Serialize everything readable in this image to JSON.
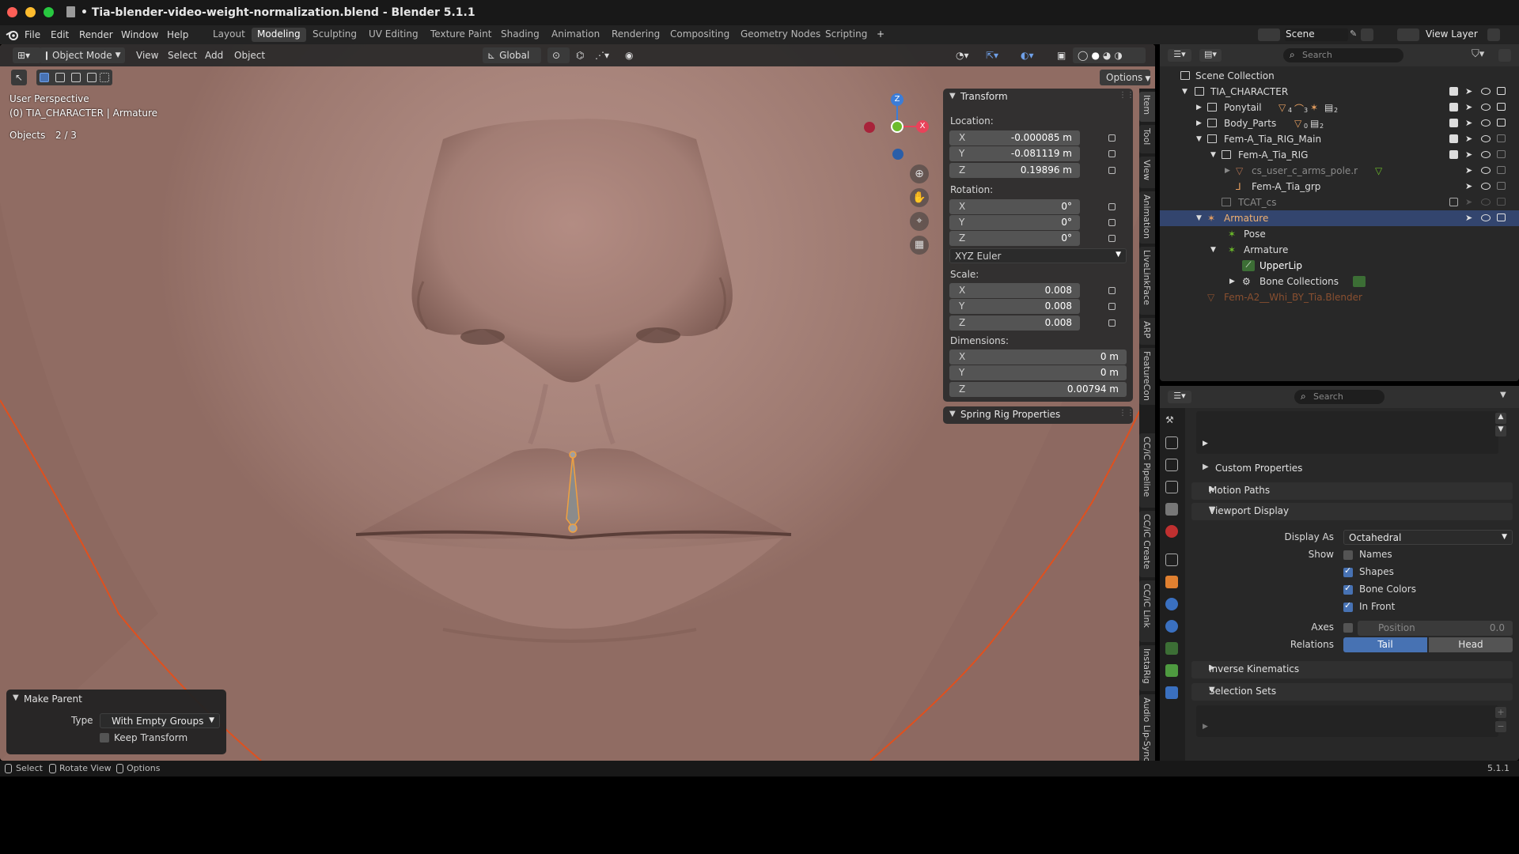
{
  "window": {
    "title": "• Tia-blender-video-weight-normalization.blend - Blender 5.1.1"
  },
  "menu": [
    "File",
    "Edit",
    "Render",
    "Window",
    "Help"
  ],
  "workspaces": [
    {
      "label": "Layout"
    },
    {
      "label": "Modeling",
      "active": true
    },
    {
      "label": "Sculpting"
    },
    {
      "label": "UV Editing"
    },
    {
      "label": "Texture Paint"
    },
    {
      "label": "Shading"
    },
    {
      "label": "Animation"
    },
    {
      "label": "Rendering"
    },
    {
      "label": "Compositing"
    },
    {
      "label": "Geometry Nodes"
    },
    {
      "label": "Scripting"
    },
    {
      "label": "+"
    }
  ],
  "top_right": {
    "scene": "Scene",
    "view_layer": "View Layer"
  },
  "viewport": {
    "mode": "Object Mode",
    "menus": [
      "View",
      "Select",
      "Add",
      "Object"
    ],
    "orientation": "Global",
    "options_label": "Options",
    "perspective": "User Perspective",
    "context": "(0) TIA_CHARACTER | Armature",
    "objects_label": "Objects",
    "objects_count": "2 / 3",
    "gizmo": {
      "z": "Z",
      "x": "X"
    }
  },
  "transform_panel": {
    "title": "Transform",
    "location_label": "Location:",
    "location": [
      {
        "axis": "X",
        "value": "-0.000085 m"
      },
      {
        "axis": "Y",
        "value": "-0.081119 m"
      },
      {
        "axis": "Z",
        "value": "0.19896 m"
      }
    ],
    "rotation_label": "Rotation:",
    "rotation": [
      {
        "axis": "X",
        "value": "0°"
      },
      {
        "axis": "Y",
        "value": "0°"
      },
      {
        "axis": "Z",
        "value": "0°"
      }
    ],
    "rotation_mode": "XYZ Euler",
    "scale_label": "Scale:",
    "scale": [
      {
        "axis": "X",
        "value": "0.008"
      },
      {
        "axis": "Y",
        "value": "0.008"
      },
      {
        "axis": "Z",
        "value": "0.008"
      }
    ],
    "dimensions_label": "Dimensions:",
    "dimensions": [
      {
        "axis": "X",
        "value": "0 m"
      },
      {
        "axis": "Y",
        "value": "0 m"
      },
      {
        "axis": "Z",
        "value": "0.00794 m"
      }
    ],
    "spring_rig": "Spring Rig Properties"
  },
  "side_tabs": [
    "Item",
    "Tool",
    "View",
    "Animation",
    "LiveLinkFace",
    "ARP",
    "FeatureCon",
    "CC/iC Pipeline",
    "CC/iC Create",
    "CC/iC Link",
    "InstaRig",
    "Audio Lip-Sync"
  ],
  "operator_panel": {
    "title": "Make Parent",
    "type_label": "Type",
    "type_value": "With Empty Groups",
    "keep_transform": "Keep Transform"
  },
  "status_bar": {
    "select": "Select",
    "rotate": "Rotate View",
    "options": "Options",
    "version": "5.1.1"
  },
  "outliner": {
    "search_placeholder": "Search",
    "rows": [
      {
        "label": "Scene Collection"
      },
      {
        "label": "TIA_CHARACTER"
      },
      {
        "label": "Ponytail"
      },
      {
        "label": "Body_Parts"
      },
      {
        "label": "Fem-A_Tia_RIG_Main"
      },
      {
        "label": "Fem-A_Tia_RIG"
      },
      {
        "label": "cs_user_c_arms_pole.r"
      },
      {
        "label": "Fem-A_Tia_grp"
      },
      {
        "label": "TCAT_cs"
      },
      {
        "label": "Armature",
        "selected": true
      },
      {
        "label": "Pose"
      },
      {
        "label": "Armature"
      },
      {
        "label": "UpperLip"
      },
      {
        "label": "Bone Collections"
      },
      {
        "label": "Fem-A2__Whi_BY_Tia.Blender"
      }
    ],
    "badges": {
      "ponytail_1": "4",
      "ponytail_2": "3",
      "ponytail_3": "2",
      "body_1": "0",
      "body_2": "2"
    }
  },
  "properties": {
    "search_placeholder": "Search",
    "custom_properties": "Custom Properties",
    "motion_paths": "Motion Paths",
    "viewport_display": "Viewport Display",
    "display_as_label": "Display As",
    "display_as_value": "Octahedral",
    "show_label": "Show",
    "names": {
      "label": "Names",
      "checked": false
    },
    "shapes": {
      "label": "Shapes",
      "checked": true
    },
    "bone_colors": {
      "label": "Bone Colors",
      "checked": true
    },
    "in_front": {
      "label": "In Front",
      "checked": true
    },
    "axes_label": "Axes",
    "axes_position_label": "Position",
    "axes_position_value": "0.0",
    "relations_label": "Relations",
    "relations_tail": "Tail",
    "relations_head": "Head",
    "inverse_kinematics": "Inverse Kinematics",
    "selection_sets": "Selection Sets"
  },
  "colors": {
    "accent": "#4772b3",
    "selection_row": "#33456e",
    "outline_orange": "#e0501e",
    "bone_orange": "#f0a040"
  }
}
